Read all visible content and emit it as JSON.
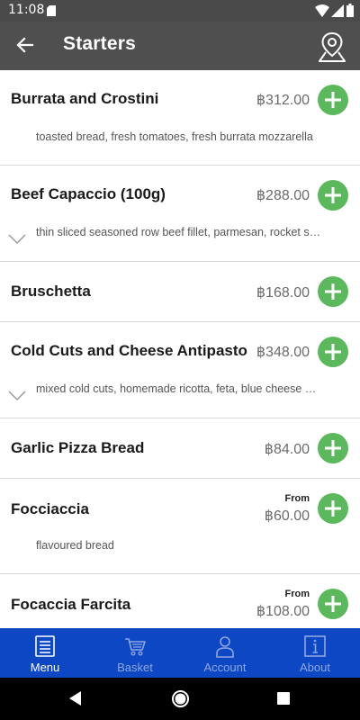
{
  "status_bar": {
    "time": "11:08",
    "icons": [
      "sd-card-icon",
      "wifi-icon",
      "signal-icon",
      "battery-icon"
    ]
  },
  "app_bar": {
    "title": "Starters",
    "back_icon": "arrow-left-icon",
    "map_icon": "map-pin-icon"
  },
  "colors": {
    "app_bar": "#4f4f4f",
    "add_button": "#5cb85c",
    "bottom_nav": "#0d47c4",
    "nav_inactive": "#8ea6e0"
  },
  "items": [
    {
      "name": "Burrata and Crostini",
      "price": "฿312.00",
      "from": "",
      "description": "toasted bread, fresh tomatoes, fresh burrata mozzarella",
      "expandable": false
    },
    {
      "name": "Beef Capaccio (100g)",
      "price": "฿288.00",
      "from": "",
      "description": "thin sliced seasoned row beef fillet, parmesan, rocket s…",
      "expandable": true
    },
    {
      "name": "Bruschetta",
      "price": "฿168.00",
      "from": "",
      "description": "",
      "expandable": false
    },
    {
      "name": "Cold Cuts and Cheese Antipasto",
      "price": "฿348.00",
      "from": "",
      "description": "mixed cold cuts, homemade ricotta, feta, blue cheese …",
      "expandable": true
    },
    {
      "name": "Garlic Pizza Bread",
      "price": "฿84.00",
      "from": "",
      "description": "",
      "expandable": false
    },
    {
      "name": "Focciaccia",
      "price": "฿60.00",
      "from": "From",
      "description": "flavoured bread",
      "expandable": false
    },
    {
      "name": "Focaccia Farcita",
      "price": "฿108.00",
      "from": "From",
      "description": "",
      "expandable": false
    }
  ],
  "bottom_nav": {
    "tabs": [
      {
        "label": "Menu",
        "icon": "menu-book-icon",
        "active": true
      },
      {
        "label": "Basket",
        "icon": "basket-icon",
        "active": false
      },
      {
        "label": "Account",
        "icon": "account-icon",
        "active": false
      },
      {
        "label": "About",
        "icon": "info-icon",
        "active": false
      }
    ]
  },
  "system_nav": {
    "icons": [
      "system-back-icon",
      "system-home-icon",
      "system-recents-icon"
    ]
  }
}
